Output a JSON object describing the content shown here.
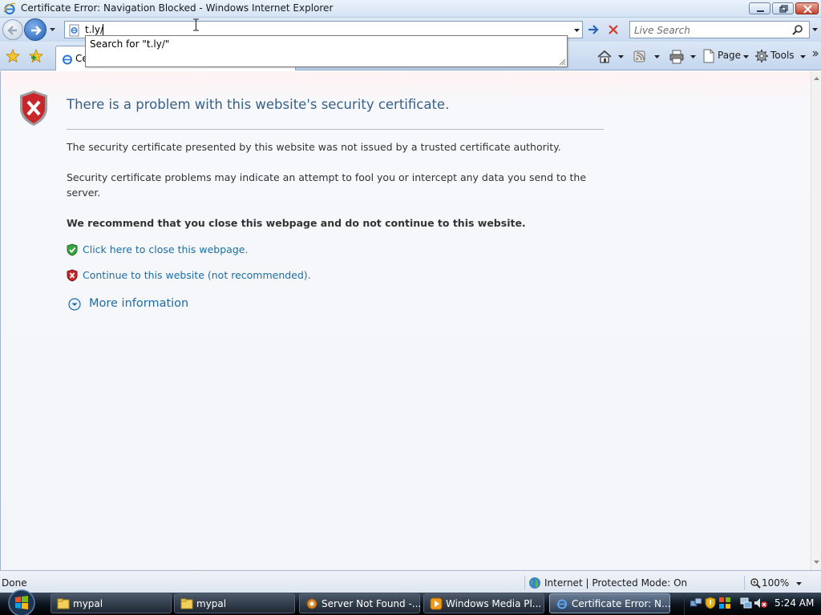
{
  "window": {
    "title": "Certificate Error: Navigation Blocked - Windows Internet Explorer"
  },
  "nav": {
    "address_value": "t.ly/",
    "search_placeholder": "Live Search",
    "autocomplete_item": "Search for \"t.ly/\""
  },
  "tab": {
    "label": "Certificate Error: Navigation Blocked"
  },
  "commandbar": {
    "page_label": "Page",
    "tools_label": "Tools"
  },
  "content": {
    "title": "There is a problem with this website's security certificate.",
    "para1": "The security certificate presented by this website was not issued by a trusted certificate authority.",
    "para2": "Security certificate problems may indicate an attempt to fool you or intercept any data you send to the server.",
    "recommend": "We recommend that you close this webpage and do not continue to this website.",
    "close_link": "Click here to close this webpage.",
    "continue_link": "Continue to this website (not recommended).",
    "more_info": "More information"
  },
  "statusbar": {
    "status": "Done",
    "zone": "Internet | Protected Mode: On",
    "zoom": "100%"
  },
  "taskbar": {
    "items": [
      {
        "label": "mypal",
        "icon": "folder-icon"
      },
      {
        "label": "mypal",
        "icon": "folder-icon"
      },
      {
        "label": "Server Not Found -...",
        "icon": "browser-icon"
      },
      {
        "label": "Windows Media Pl...",
        "icon": "media-player-icon"
      },
      {
        "label": "Certificate Error: N...",
        "icon": "ie-icon"
      }
    ],
    "clock": "5:24 AM"
  },
  "colors": {
    "title_blue": "#385f86",
    "link_blue": "#1b6ea5",
    "error_red": "#c8262b",
    "safe_green": "#3aa341"
  }
}
